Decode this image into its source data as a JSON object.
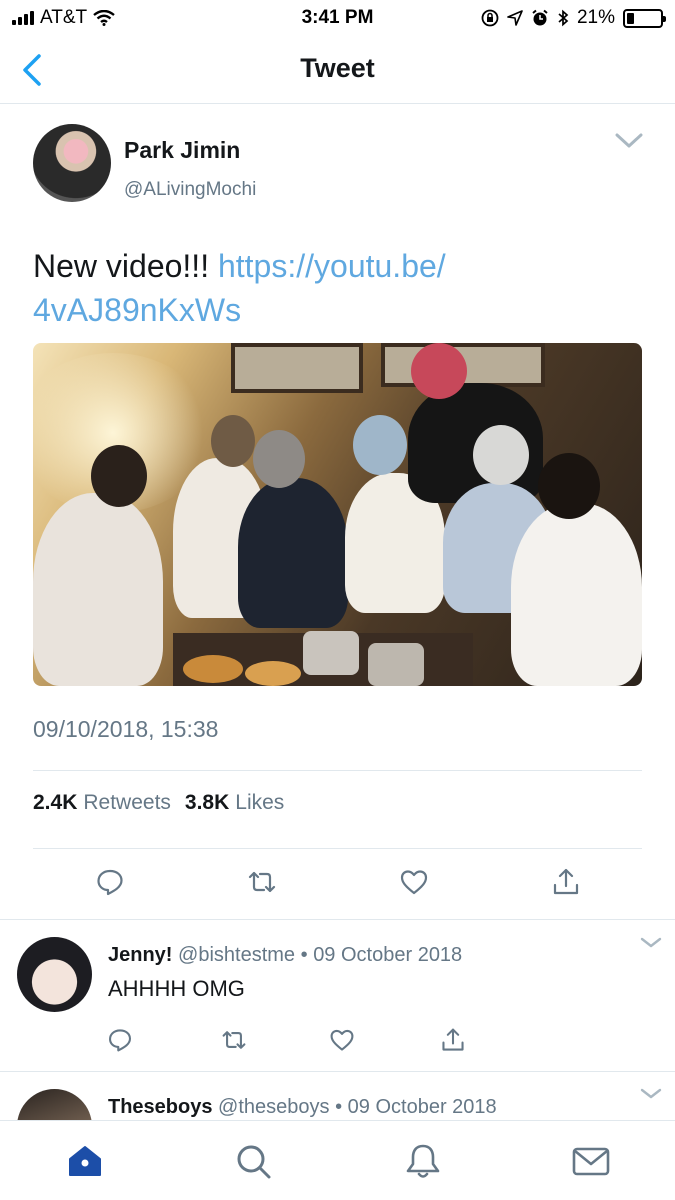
{
  "status_bar": {
    "carrier": "AT&T",
    "time": "3:41 PM",
    "battery_percent": "21%",
    "battery_level": 0.21
  },
  "nav": {
    "title": "Tweet",
    "back_icon": "chevron-left-icon"
  },
  "tweet": {
    "author_name": "Park Jimin",
    "author_handle": "@ALivingMochi",
    "text": "New video!!! ",
    "link_line1": "https://youtu.be/",
    "link_line2": "4vAJ89nKxWs",
    "timestamp": "09/10/2018, 15:38",
    "retweets_count": "2.4K",
    "retweets_label": "Retweets",
    "likes_count": "3.8K",
    "likes_label": "Likes"
  },
  "replies": [
    {
      "name": "Jenny!",
      "handle": "@bishtestme",
      "date": "09 October 2018",
      "text": "AHHHH OMG"
    },
    {
      "name": "Theseboys",
      "handle": "@theseboys",
      "date": "09 October 2018",
      "text": ""
    }
  ],
  "separator": "•",
  "tabbar": {
    "tabs": [
      "home-icon",
      "search-icon",
      "bell-icon",
      "mail-icon"
    ],
    "active_color": "#1c4ea8",
    "inactive_color": "#657786"
  },
  "colors": {
    "accent": "#1da1f2",
    "link": "#5fa8e0",
    "secondary_text": "#657786"
  }
}
